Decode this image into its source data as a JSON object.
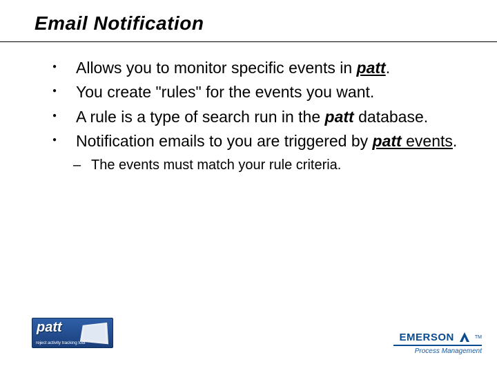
{
  "title": "Email Notification",
  "bullets": {
    "b1": {
      "pre": "Allows you to monitor specific events in ",
      "em": "patt",
      "post": "."
    },
    "b2": "You create \"rules\" for the events you want.",
    "b3": {
      "pre": "A rule is a type of search run in the ",
      "em": "patt",
      "post": " database."
    },
    "b4": {
      "pre": "Notification emails to you are triggered by ",
      "em": "patt",
      "post_u": " events",
      "post": "."
    }
  },
  "sub1": "The events must match your rule criteria.",
  "footer": {
    "patt_name": "patt",
    "patt_tag": "reject activity tracking tool",
    "emerson_name": "EMERSON",
    "emerson_sub": "Process Management",
    "tm": "TM"
  }
}
